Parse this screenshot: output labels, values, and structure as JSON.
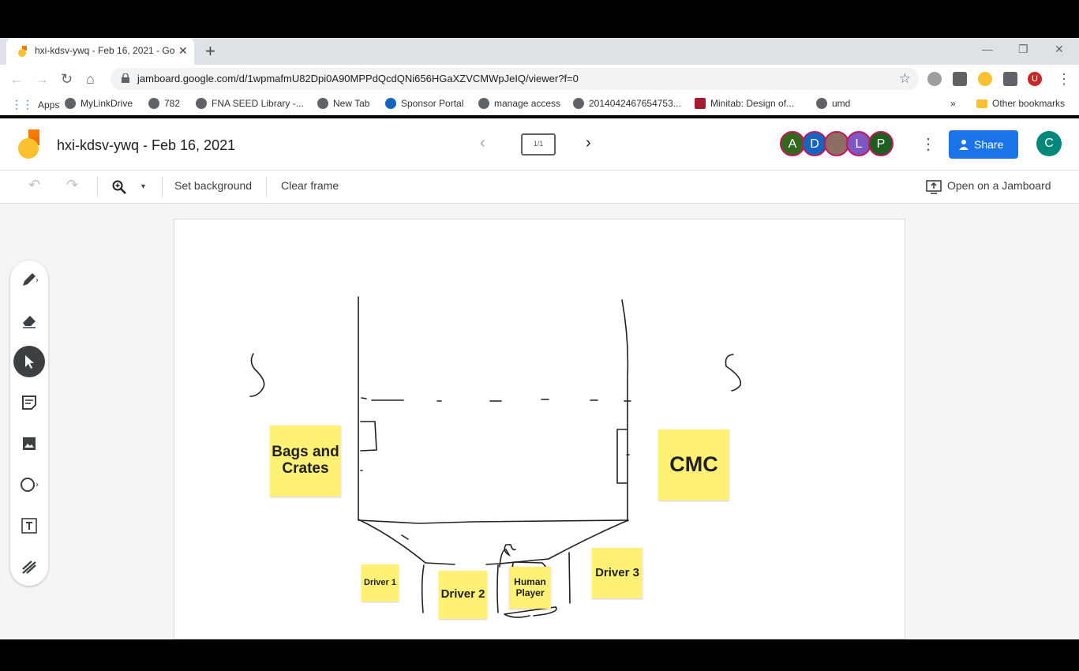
{
  "browser": {
    "tab_title": "hxi-kdsv-ywq - Feb 16, 2021 - Go",
    "url": "jamboard.google.com/d/1wpmafmU82Dpi0A90MPPdQcdQNi656HGaXZVCMWpJeIQ/viewer?f=0",
    "bookmarks": [
      "Apps",
      "MyLinkDrive",
      "782",
      "FNA SEED Library -...",
      "New Tab",
      "Sponsor Portal",
      "manage access",
      "2014042467654753...",
      "Minitab: Design of...",
      "umd"
    ],
    "other_bookmarks": "Other bookmarks",
    "profile_initial": "U"
  },
  "app": {
    "title": "hxi-kdsv-ywq - Feb 16, 2021",
    "frame_indicator": "1/1",
    "collaborators": [
      {
        "initial": "A",
        "color": "#33691e"
      },
      {
        "initial": "D",
        "color": "#1565c0"
      },
      {
        "initial": "",
        "color": "#8d6e63"
      },
      {
        "initial": "L",
        "color": "#7e57c2"
      },
      {
        "initial": "P",
        "color": "#1b5e20"
      }
    ],
    "share_label": "Share",
    "user_initial": "C",
    "set_background": "Set background",
    "clear_frame": "Clear frame",
    "open_on_jamboard": "Open on a Jamboard"
  },
  "stickies": {
    "bags": "Bags and Crates",
    "cmc": "CMC",
    "driver1": "Driver 1",
    "driver2": "Driver 2",
    "human": "Human Player",
    "driver3": "Driver 3"
  },
  "colors": {
    "sticky": "#fff176",
    "share": "#1a73e8",
    "user": "#00897b"
  }
}
